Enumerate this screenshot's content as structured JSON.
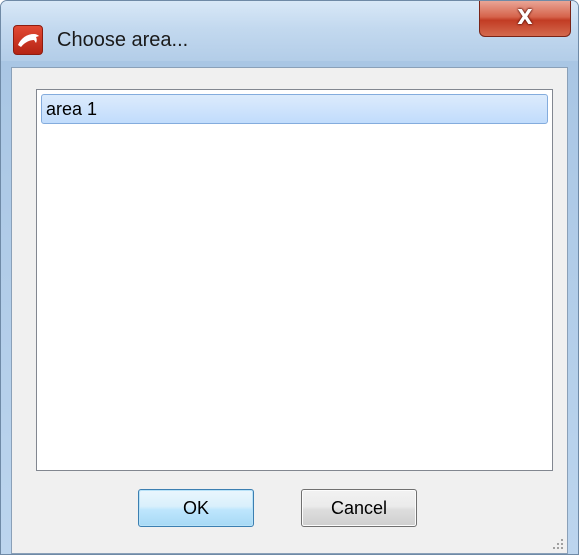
{
  "window": {
    "title": "Choose area...",
    "close_label": "X",
    "app_icon": "dolphin-icon"
  },
  "list": {
    "items": [
      {
        "label": "area 1",
        "selected": true
      }
    ]
  },
  "buttons": {
    "ok_label": "OK",
    "cancel_label": "Cancel"
  },
  "colors": {
    "selection": "#c1dcfc",
    "close_button": "#c23c24",
    "app_icon": "#d0341f"
  }
}
